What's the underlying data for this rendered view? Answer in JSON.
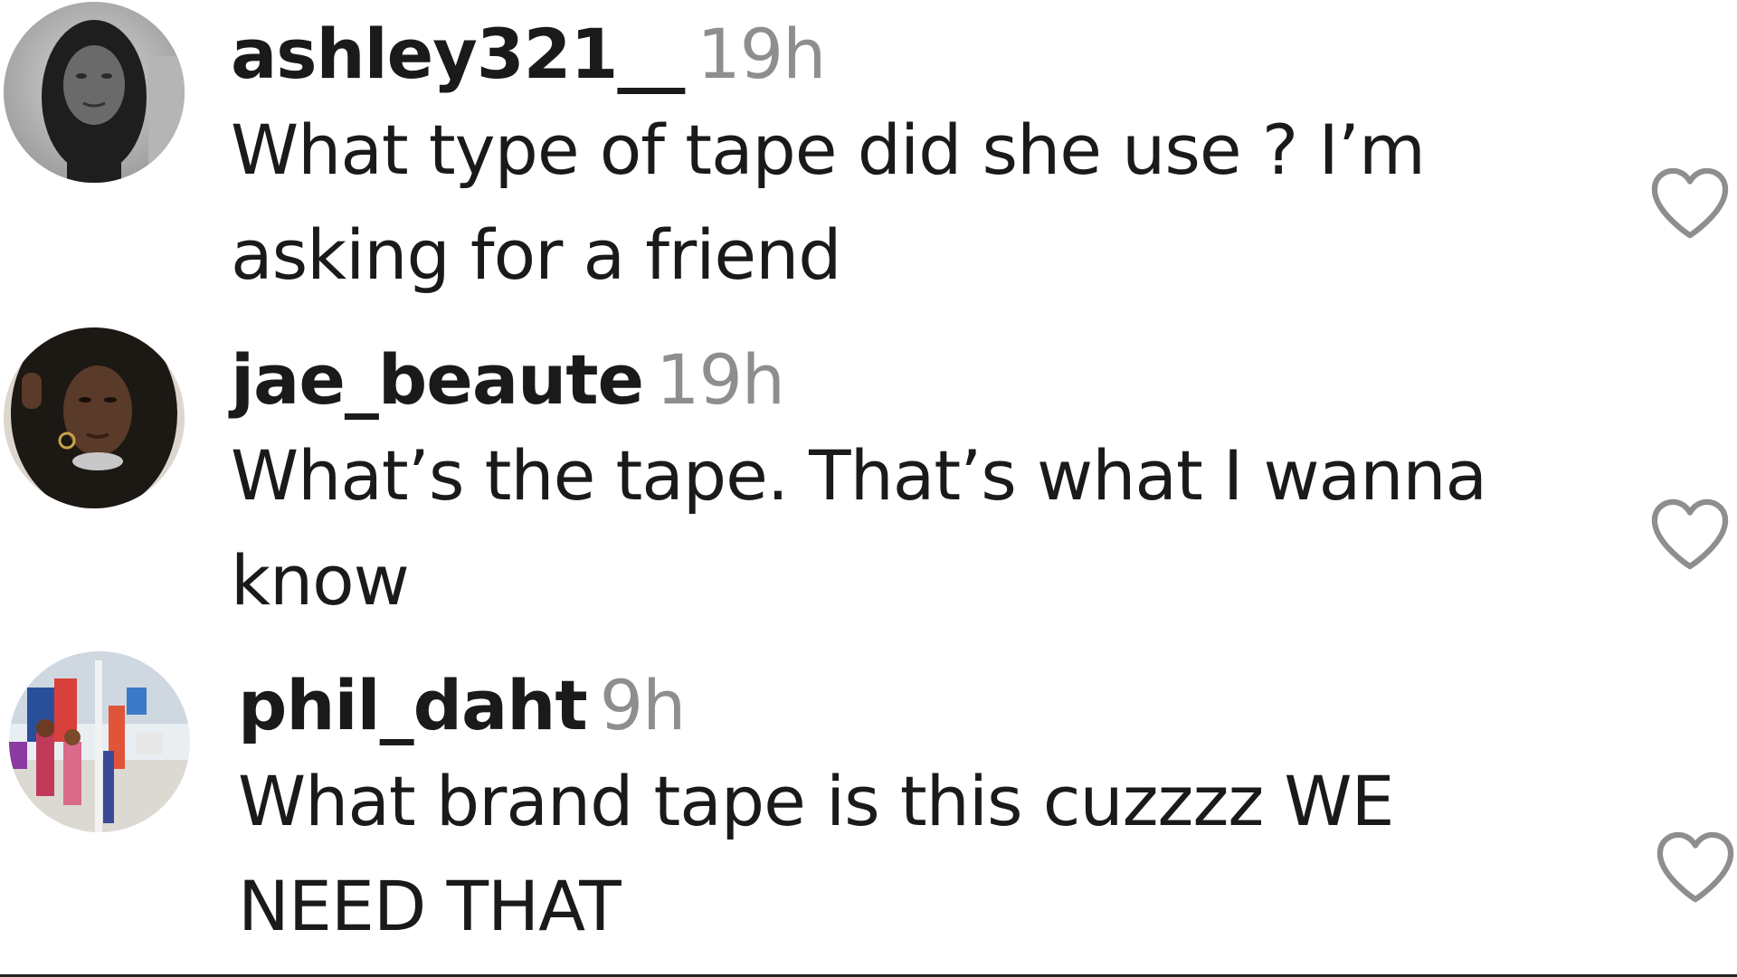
{
  "comments": [
    {
      "username": "ashley321__",
      "time": "19h",
      "text": "What type of tape did she use ? I’m asking for a friend",
      "avatar_icon": "avatar-grayscale-portrait"
    },
    {
      "username": "jae_beaute",
      "time": "19h",
      "text": "What’s the tape. That’s what I wanna know",
      "avatar_icon": "avatar-portrait"
    },
    {
      "username": "phil_daht",
      "time": "9h",
      "text": "What brand tape is this cuzzzz WE NEED THAT",
      "avatar_icon": "avatar-carnival-photo"
    }
  ],
  "icons": {
    "like": "heart-outline-icon"
  },
  "colors": {
    "text": "#1a1a1a",
    "timestamp": "#8e8e8e",
    "heart_stroke": "#8e8e8e"
  }
}
